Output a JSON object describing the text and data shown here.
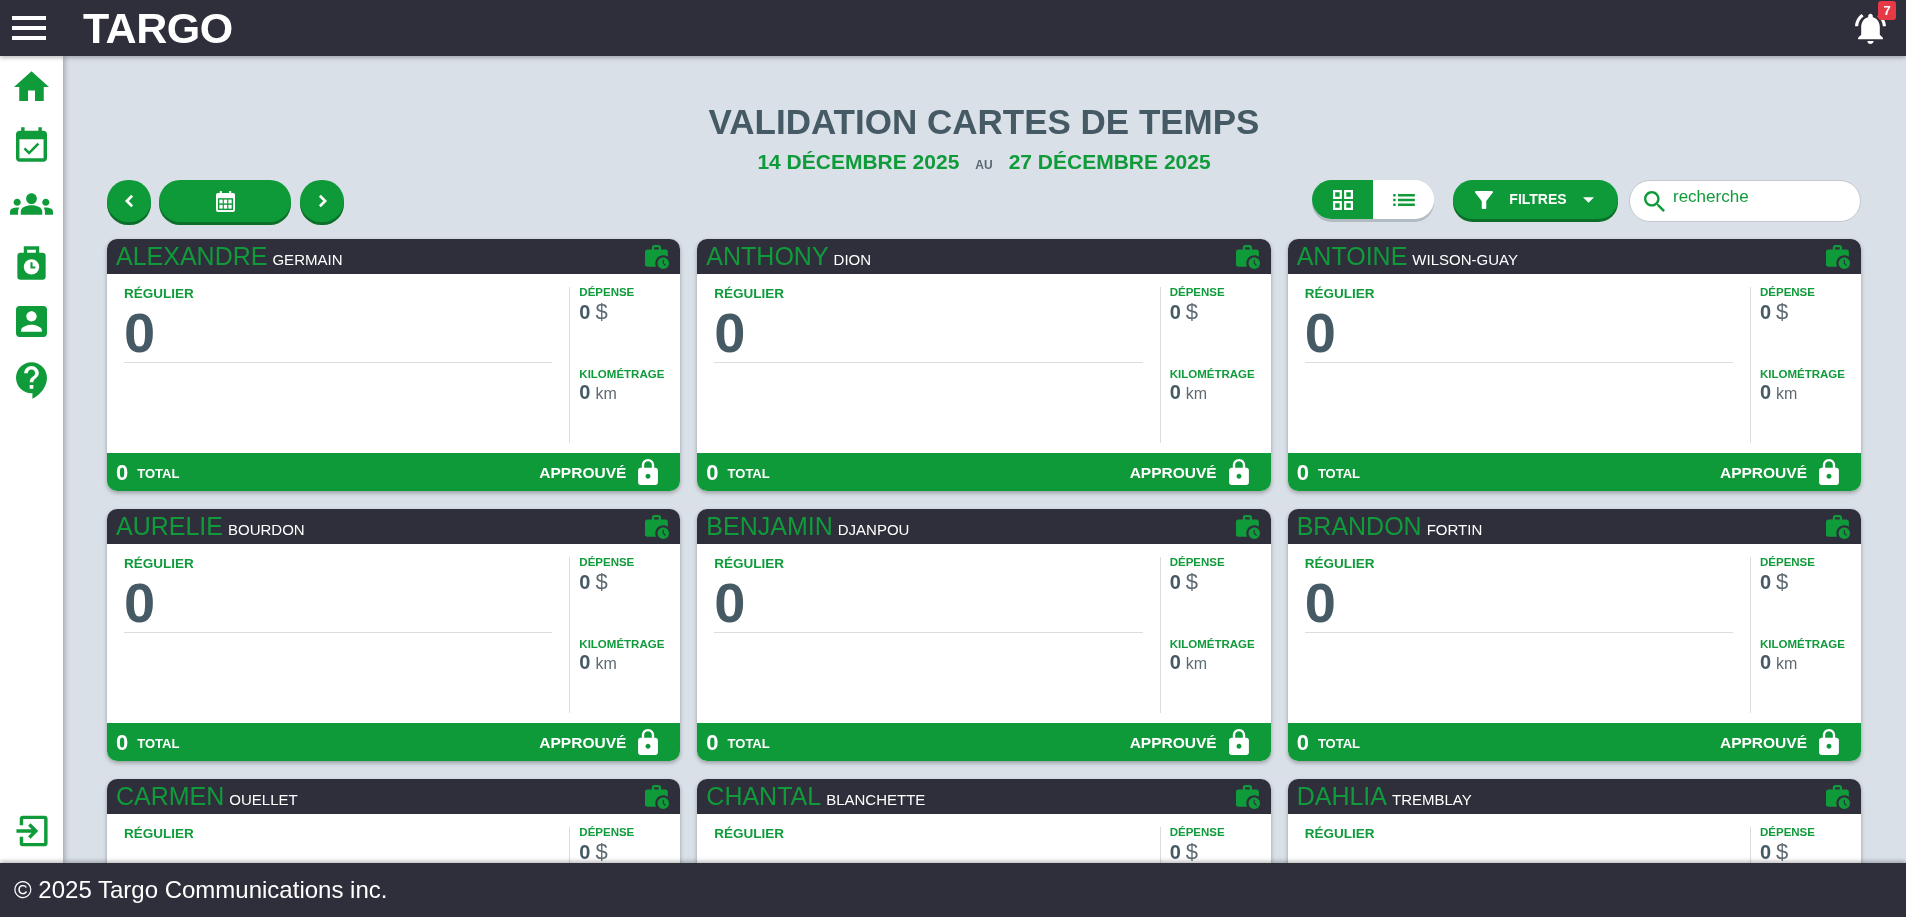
{
  "top_bar": {
    "logo": "TARGO",
    "notification_count": "7"
  },
  "header": {
    "title": "VALIDATION CARTES DE TEMPS",
    "period": {
      "start": "14 DÉCEMBRE 2025",
      "separator": "AU",
      "end": "27 DÉCEMBRE 2025"
    }
  },
  "toolbar": {
    "view_toggle": [
      {
        "kind": "grid",
        "selected": true
      },
      {
        "kind": "list",
        "selected": false
      }
    ],
    "filter_button": "FILTRES",
    "search": {
      "placeholder": "recherche"
    }
  },
  "cards": [
    {
      "first_name": "ALEXANDRE",
      "last_name": "GERMAIN",
      "regular": {
        "label": "RÉGULIER",
        "value": "0"
      },
      "expense": {
        "label": "DÉPENSE",
        "value": "0",
        "unit": "$"
      },
      "mileage": {
        "label": "KILOMÉTRAGE",
        "value": "0",
        "unit": "km"
      },
      "total": {
        "value": "0",
        "label": "TOTAL"
      },
      "status": "APPROUVÉ"
    },
    {
      "first_name": "ANTHONY",
      "last_name": "DION",
      "regular": {
        "label": "RÉGULIER",
        "value": "0"
      },
      "expense": {
        "label": "DÉPENSE",
        "value": "0",
        "unit": "$"
      },
      "mileage": {
        "label": "KILOMÉTRAGE",
        "value": "0",
        "unit": "km"
      },
      "total": {
        "value": "0",
        "label": "TOTAL"
      },
      "status": "APPROUVÉ"
    },
    {
      "first_name": "ANTOINE",
      "last_name": "WILSON-GUAY",
      "regular": {
        "label": "RÉGULIER",
        "value": "0"
      },
      "expense": {
        "label": "DÉPENSE",
        "value": "0",
        "unit": "$"
      },
      "mileage": {
        "label": "KILOMÉTRAGE",
        "value": "0",
        "unit": "km"
      },
      "total": {
        "value": "0",
        "label": "TOTAL"
      },
      "status": "APPROUVÉ"
    },
    {
      "first_name": "AURELIE",
      "last_name": "BOURDON",
      "regular": {
        "label": "RÉGULIER",
        "value": "0"
      },
      "expense": {
        "label": "DÉPENSE",
        "value": "0",
        "unit": "$"
      },
      "mileage": {
        "label": "KILOMÉTRAGE",
        "value": "0",
        "unit": "km"
      },
      "total": {
        "value": "0",
        "label": "TOTAL"
      },
      "status": "APPROUVÉ"
    },
    {
      "first_name": "BENJAMIN",
      "last_name": "DJANPOU",
      "regular": {
        "label": "RÉGULIER",
        "value": "0"
      },
      "expense": {
        "label": "DÉPENSE",
        "value": "0",
        "unit": "$"
      },
      "mileage": {
        "label": "KILOMÉTRAGE",
        "value": "0",
        "unit": "km"
      },
      "total": {
        "value": "0",
        "label": "TOTAL"
      },
      "status": "APPROUVÉ"
    },
    {
      "first_name": "BRANDON",
      "last_name": "FORTIN",
      "regular": {
        "label": "RÉGULIER",
        "value": "0"
      },
      "expense": {
        "label": "DÉPENSE",
        "value": "0",
        "unit": "$"
      },
      "mileage": {
        "label": "KILOMÉTRAGE",
        "value": "0",
        "unit": "km"
      },
      "total": {
        "value": "0",
        "label": "TOTAL"
      },
      "status": "APPROUVÉ"
    },
    {
      "first_name": "CARMEN",
      "last_name": "OUELLET",
      "regular": {
        "label": "RÉGULIER"
      },
      "expense": {
        "label": "DÉPENSE",
        "value": "0",
        "unit": "$"
      }
    },
    {
      "first_name": "CHANTAL",
      "last_name": "BLANCHETTE",
      "regular": {
        "label": "RÉGULIER"
      },
      "expense": {
        "label": "DÉPENSE",
        "value": "0",
        "unit": "$"
      }
    },
    {
      "first_name": "DAHLIA",
      "last_name": "TREMBLAY",
      "regular": {
        "label": "RÉGULIER"
      },
      "expense": {
        "label": "DÉPENSE",
        "value": "0",
        "unit": "$"
      }
    }
  ],
  "footer": {
    "text": "© 2025 Targo Communications inc."
  }
}
